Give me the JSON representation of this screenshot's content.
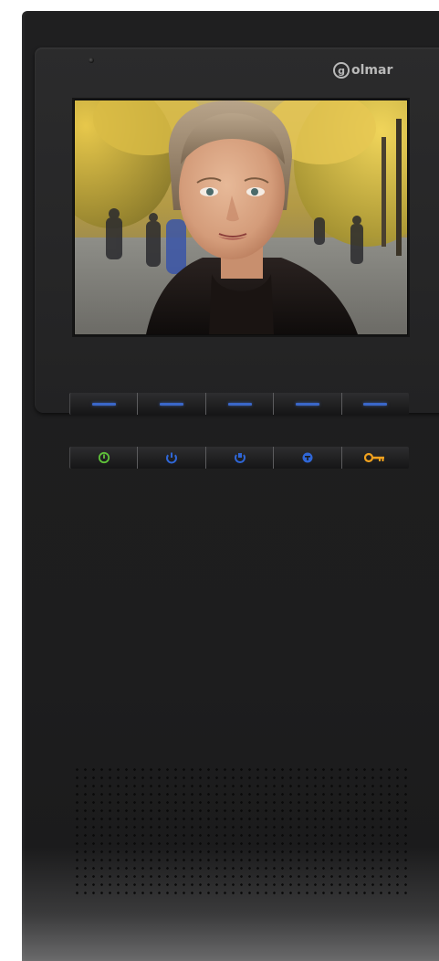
{
  "brand": {
    "logo_text": "olmar",
    "logo_mark": "g"
  },
  "screen": {
    "content": "video-feed-woman-autumn-street"
  },
  "function_keys": [
    {
      "indicator": "blue-dash"
    },
    {
      "indicator": "blue-dash"
    },
    {
      "indicator": "blue-dash"
    },
    {
      "indicator": "blue-dash"
    },
    {
      "indicator": "blue-dash"
    }
  ],
  "control_keys": [
    {
      "icon": "power-icon",
      "color": "#5fc23a"
    },
    {
      "icon": "handset-icon",
      "color": "#2f66d6"
    },
    {
      "icon": "monitor-icon",
      "color": "#2f66d6"
    },
    {
      "icon": "intercom-icon",
      "color": "#2f66d6"
    },
    {
      "icon": "key-icon",
      "color": "#f0a11e"
    }
  ],
  "colors": {
    "body": "#1f1f20",
    "bezel": "#2b2b2c",
    "indicator_blue": "#3a67c9",
    "power_green": "#5fc23a",
    "key_orange": "#f0a11e"
  }
}
